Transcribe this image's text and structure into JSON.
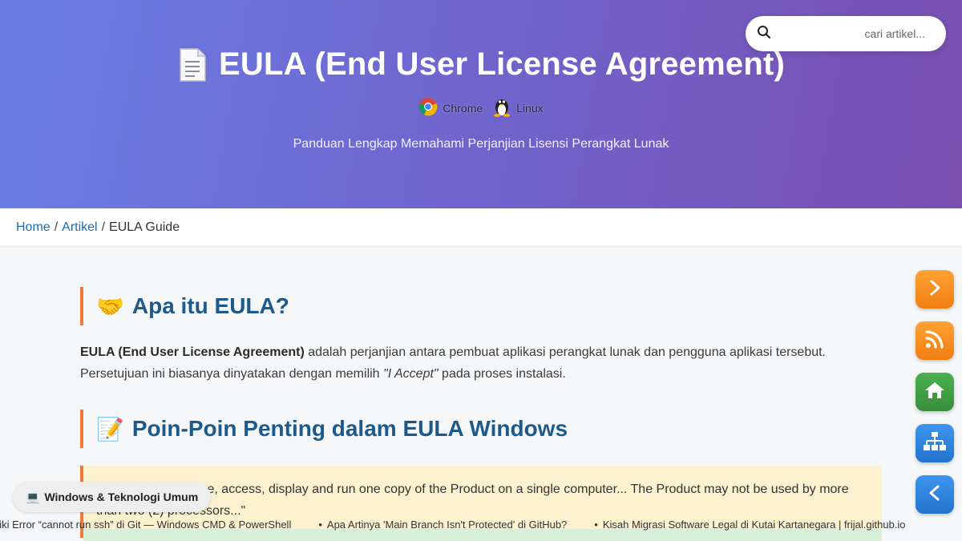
{
  "hero": {
    "title": "EULA (End User License Agreement)",
    "platforms": [
      {
        "name": "Chrome",
        "icon": "chrome-icon"
      },
      {
        "name": "Linux",
        "icon": "linux-tux-icon"
      }
    ],
    "subtitle": "Panduan Lengkap Memahami Perjanjian Lisensi Perangkat Lunak"
  },
  "search": {
    "placeholder": "cari artikel...",
    "icon": "search-icon"
  },
  "breadcrumb": {
    "home": "Home",
    "articles": "Artikel",
    "separator": "/",
    "current": "EULA Guide"
  },
  "content": {
    "section1": {
      "emoji": "🤝",
      "heading": "Apa itu EULA?",
      "bold": "EULA (End User License Agreement)",
      "text1": " adalah perjanjian antara pembuat aplikasi perangkat lunak dan pengguna aplikasi tersebut. Persetujuan ini biasanya dinyatakan dengan memilih ",
      "italic": "\"I Accept\"",
      "text2": " pada proses instalasi."
    },
    "section2": {
      "emoji": "📝",
      "heading": "Poin-Poin Penting dalam EULA Windows",
      "quote_line1": "\"You may install, use, access, display and run one copy of the Product on a single computer... The Product may not be used by more",
      "quote_line2": "than two (2) processors...\""
    }
  },
  "category_chip": {
    "emoji": "💻",
    "label": "Windows & Teknologi Umum"
  },
  "ticker": [
    "aiki Error “cannot run ssh” di Git — Windows CMD & PowerShell",
    "Apa Artinya 'Main Branch Isn't Protected' di GitHub?",
    "Kisah Migrasi Software Legal di Kutai Kartanegara | frijal.github.io"
  ],
  "ticker_bullet": "•",
  "side_buttons": [
    {
      "icon": "chevron-right-icon",
      "color": "#f7901e"
    },
    {
      "icon": "rss-icon",
      "color": "#f7901e"
    },
    {
      "icon": "home-icon",
      "color": "#43a047"
    },
    {
      "icon": "sitemap-icon",
      "color": "#2f86e0"
    },
    {
      "icon": "chevron-left-icon",
      "color": "#2f86e0"
    }
  ],
  "colors": {
    "accent": "#f07a3a",
    "heading": "#1d5a8c",
    "link": "#1b6fb3",
    "quote_bg": "#fdf2cf"
  }
}
